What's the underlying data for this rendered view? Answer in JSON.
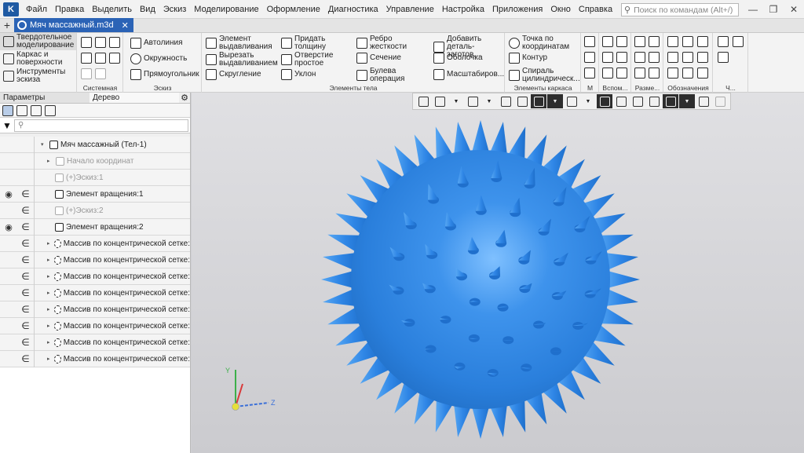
{
  "app": {
    "menu": [
      "Файл",
      "Правка",
      "Выделить",
      "Вид",
      "Эскиз",
      "Моделирование",
      "Оформление",
      "Диагностика",
      "Управление",
      "Настройка",
      "Приложения",
      "Окно",
      "Справка"
    ],
    "command_search_placeholder": "Поиск по командам (Alt+/)"
  },
  "document_tab": {
    "title": "Мяч массажный.m3d"
  },
  "ribbon": {
    "modes": [
      "Твердотельное\nмоделирование",
      "Каркас и\nповерхности",
      "Инструменты\nэскиза"
    ],
    "groups": {
      "system": "Системная",
      "sketch": "Эскиз",
      "body_elements": "Элементы тела",
      "frame_elements": "Элементы каркаса",
      "m": "М",
      "aux": "Вспом...",
      "dims": "Разме...",
      "designations": "Обозначения",
      "ch": "Ч..."
    },
    "sketch_tools": [
      "Автолиния",
      "Окружность",
      "Прямоугольник"
    ],
    "body_tools": [
      "Элемент\nвыдавливания",
      "Вырезать\nвыдавливанием",
      "Скругление",
      "Придать\nтолщину",
      "Отверстие\nпростое",
      "Уклон",
      "Ребро\nжесткости",
      "Сечение",
      "Булева\nоперация",
      "Добавить\nдеталь-заготов...",
      "Оболочка",
      "Масштабиров..."
    ],
    "frame_tools": [
      "Точка по\nкоординатам",
      "Контур",
      "Спираль\nцилиндрическ..."
    ]
  },
  "panel": {
    "tabs": [
      "Параметры",
      "Дерево"
    ],
    "active_tab": "Дерево",
    "tree": [
      {
        "label": "Мяч массажный (Тел-1)",
        "visible": false,
        "dim": false,
        "indent": 1,
        "arrow": "▾"
      },
      {
        "label": "Начало координат",
        "visible": false,
        "dim": true,
        "indent": 2,
        "arrow": "▸"
      },
      {
        "label": "(+)Эскиз:1",
        "visible": false,
        "dim": true,
        "indent": 3,
        "arrow": ""
      },
      {
        "label": "Элемент вращения:1",
        "visible": true,
        "dim": false,
        "indent": 2,
        "arrow": ""
      },
      {
        "label": "(+)Эскиз:2",
        "visible": false,
        "dim": true,
        "indent": 3,
        "arrow": ""
      },
      {
        "label": "Элемент вращения:2",
        "visible": true,
        "dim": false,
        "indent": 2,
        "arrow": ""
      },
      {
        "label": "Массив по концентрической сетке:",
        "visible": false,
        "dim": false,
        "indent": 1,
        "arrow": "▸"
      },
      {
        "label": "Массив по концентрической сетке:",
        "visible": false,
        "dim": false,
        "indent": 1,
        "arrow": "▸"
      },
      {
        "label": "Массив по концентрической сетке:",
        "visible": false,
        "dim": false,
        "indent": 1,
        "arrow": "▸"
      },
      {
        "label": "Массив по концентрической сетке:",
        "visible": false,
        "dim": false,
        "indent": 1,
        "arrow": "▸"
      },
      {
        "label": "Массив по концентрической сетке:",
        "visible": false,
        "dim": false,
        "indent": 1,
        "arrow": "▸"
      },
      {
        "label": "Массив по концентрической сетке:",
        "visible": false,
        "dim": false,
        "indent": 1,
        "arrow": "▸"
      },
      {
        "label": "Массив по концентрической сетке:",
        "visible": false,
        "dim": false,
        "indent": 1,
        "arrow": "▸"
      },
      {
        "label": "Массив по концентрической сетке:",
        "visible": false,
        "dim": false,
        "indent": 1,
        "arrow": "▸"
      }
    ]
  },
  "viewport": {
    "model_color": "#2f86e6",
    "axis_labels": {
      "x": "Z",
      "y": "Y"
    }
  },
  "colors": {
    "accent": "#2b63b6",
    "ribbon_bg": "#f3f3f3",
    "viewport_bg": "#d6d6d9"
  }
}
